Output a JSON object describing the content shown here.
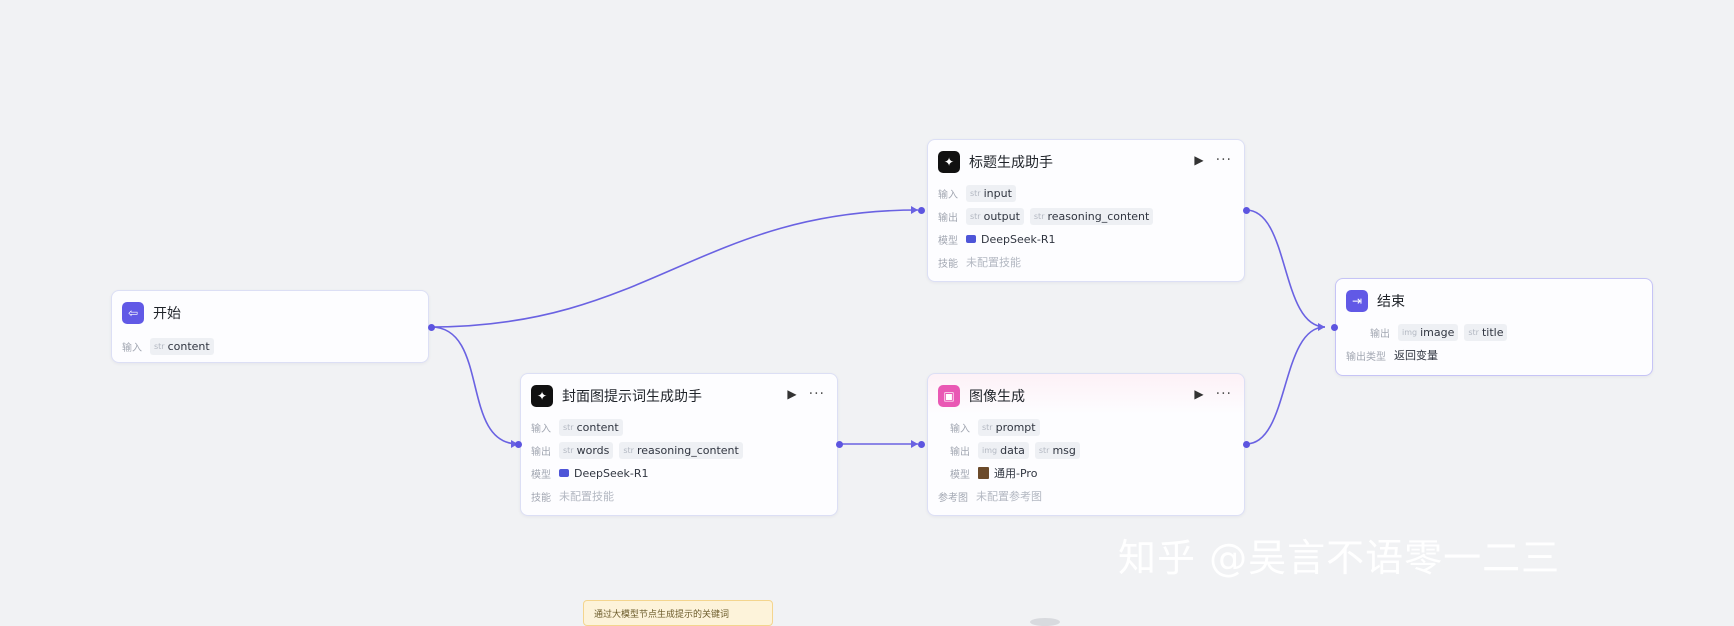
{
  "nodes": {
    "start": {
      "title": "开始",
      "input_label": "输入",
      "input": {
        "type": "str",
        "name": "content"
      }
    },
    "title_assistant": {
      "title": "标题生成助手",
      "input_label": "输入",
      "inputs": [
        {
          "type": "str",
          "name": "input"
        }
      ],
      "output_label": "输出",
      "outputs": [
        {
          "type": "str",
          "name": "output"
        },
        {
          "type": "str",
          "name": "reasoning_content"
        }
      ],
      "model_label": "模型",
      "model": "DeepSeek-R1",
      "skills_label": "技能",
      "skills": "未配置技能"
    },
    "cover_prompt": {
      "title": "封面图提示词生成助手",
      "input_label": "输入",
      "inputs": [
        {
          "type": "str",
          "name": "content"
        }
      ],
      "output_label": "输出",
      "outputs": [
        {
          "type": "str",
          "name": "words"
        },
        {
          "type": "str",
          "name": "reasoning_content"
        }
      ],
      "model_label": "模型",
      "model": "DeepSeek-R1",
      "skills_label": "技能",
      "skills": "未配置技能"
    },
    "image_gen": {
      "title": "图像生成",
      "input_label": "输入",
      "inputs": [
        {
          "type": "str",
          "name": "prompt"
        }
      ],
      "output_label": "输出",
      "outputs": [
        {
          "type": "img",
          "name": "data"
        },
        {
          "type": "str",
          "name": "msg"
        }
      ],
      "model_label": "模型",
      "model": "通用-Pro",
      "ref_label": "参考图",
      "ref": "未配置参考图"
    },
    "end": {
      "title": "结束",
      "output_label": "输出",
      "outputs": [
        {
          "type": "img",
          "name": "image"
        },
        {
          "type": "str",
          "name": "title"
        }
      ],
      "output_type_label": "输出类型",
      "output_type": "返回变量"
    }
  },
  "note_text": "通过大模型节点生成提示的关键词",
  "watermark": "知乎 @吴言不语零一二三",
  "colors": {
    "accent": "#6159e6",
    "edge": "#5d55e0",
    "canvas": "#f1f2f4"
  },
  "icons": {
    "run": "play-icon",
    "more": "more-icon"
  }
}
